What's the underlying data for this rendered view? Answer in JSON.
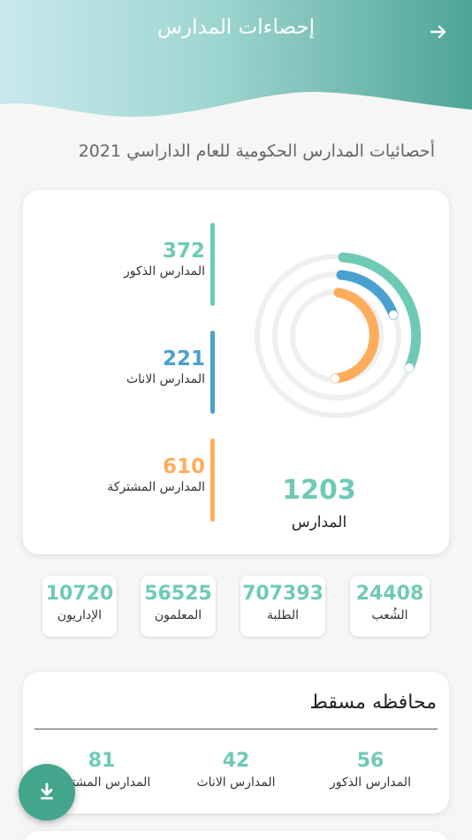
{
  "header": {
    "title": "إحصاءات المدارس"
  },
  "subtitle": "أحصائيات المدارس الحكومية  للعام الداراسي 2021",
  "colors": {
    "teal": "#6fcab5",
    "blue": "#4aa0cf",
    "orange": "#ffad5c"
  },
  "schools": {
    "male": {
      "value": "372",
      "label": "المدارس الذكور"
    },
    "female": {
      "value": "221",
      "label": "المدارس الاناث"
    },
    "mixed": {
      "value": "610",
      "label": "المدارس المشتركة"
    },
    "total": {
      "value": "1203",
      "label": "المدارس"
    }
  },
  "summary": [
    {
      "value": "10720",
      "label": "الإداريون"
    },
    {
      "value": "56525",
      "label": "المعلمون"
    },
    {
      "value": "707393",
      "label": "الطلبة"
    },
    {
      "value": "24408",
      "label": "الشُعب"
    }
  ],
  "governorate": {
    "title": "محافظه مسقط",
    "male": {
      "value": "56",
      "label": "المدارس الذكور"
    },
    "female": {
      "value": "42",
      "label": "المدارس الاناث"
    },
    "mixed": {
      "value": "81",
      "label": "المدارس المشتركة"
    }
  },
  "icons": {
    "back": "arrow-right-icon",
    "fab": "download-icon"
  }
}
